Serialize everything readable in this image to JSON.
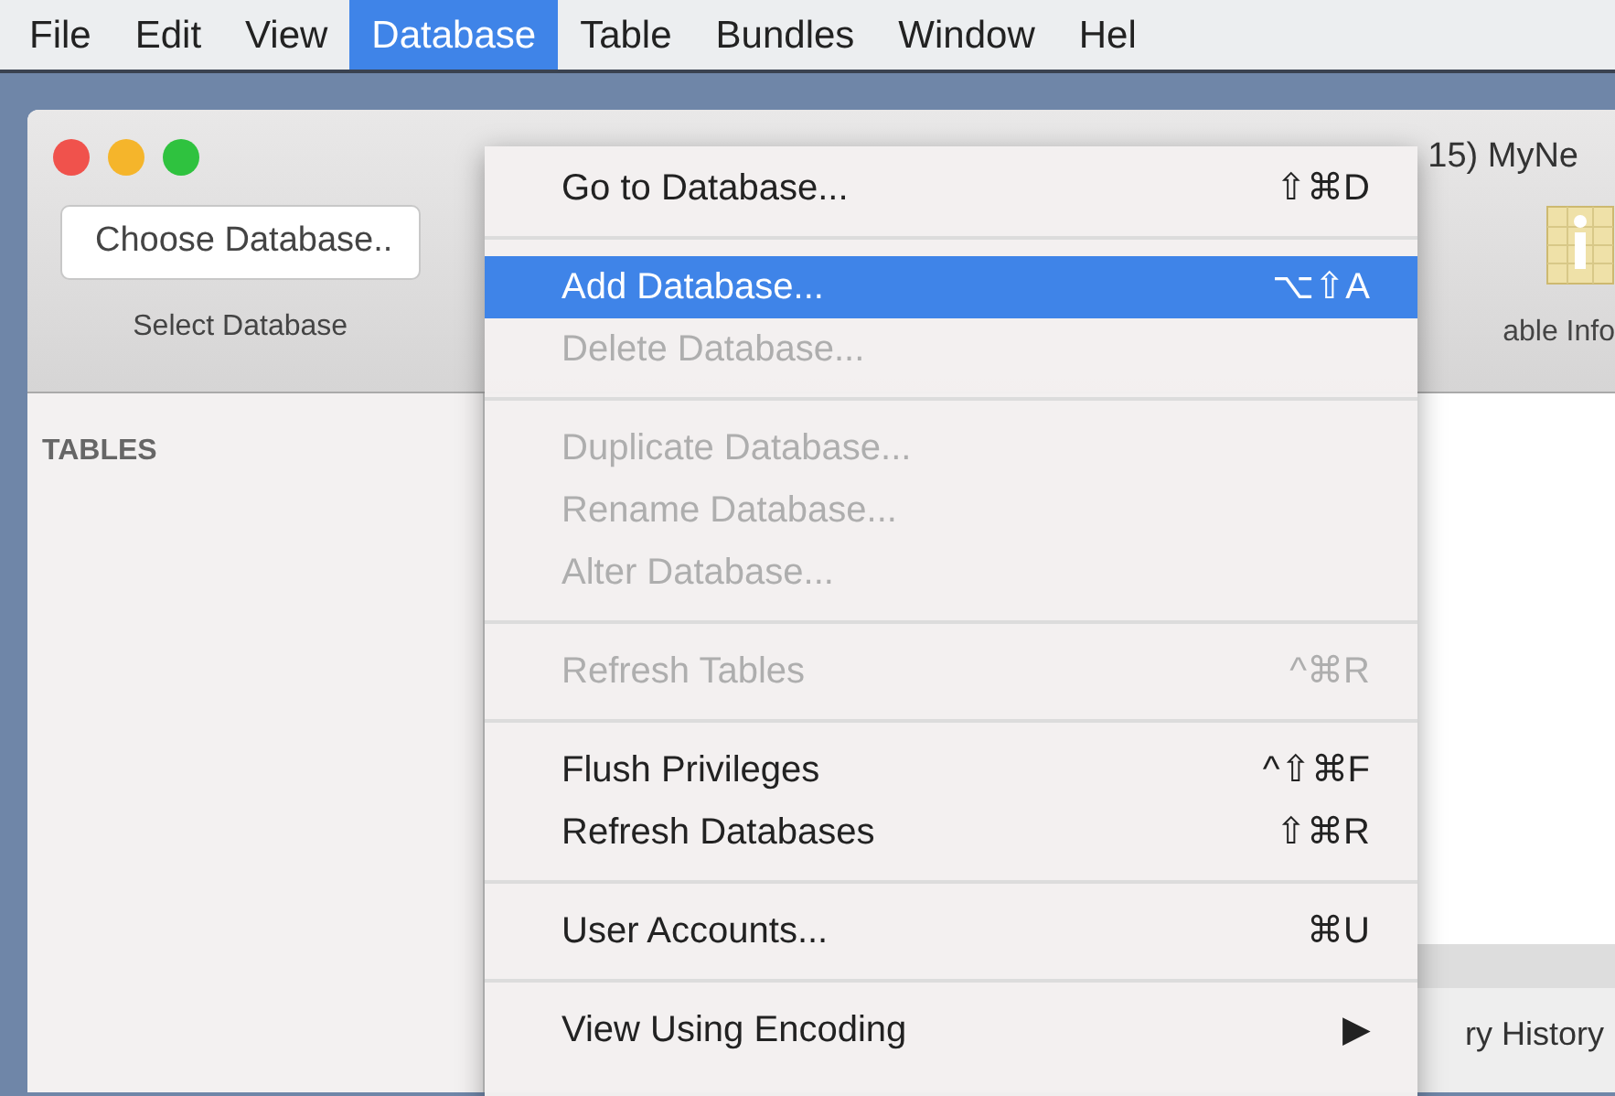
{
  "menu_bar": [
    {
      "label": "File",
      "selected": false
    },
    {
      "label": "Edit",
      "selected": false
    },
    {
      "label": "View",
      "selected": false
    },
    {
      "label": "Database",
      "selected": true
    },
    {
      "label": "Table",
      "selected": false
    },
    {
      "label": "Bundles",
      "selected": false
    },
    {
      "label": "Window",
      "selected": false
    },
    {
      "label": "Hel",
      "selected": false
    }
  ],
  "window": {
    "title": "15) MyNe",
    "toolbar": [
      {
        "kind": "button",
        "label": "Choose Database..",
        "caption": "Select Database"
      },
      {
        "kind": "icon",
        "caption": "able Info"
      }
    ],
    "sidebar": {
      "heading": "TABLES"
    },
    "bottom_tab": "ry History"
  },
  "menu": [
    {
      "kind": "item",
      "label": "Go to Database...",
      "shortcut": "⇧⌘D",
      "disabled": false,
      "selected": false
    },
    {
      "kind": "separator"
    },
    {
      "kind": "item",
      "label": "Add Database...",
      "shortcut": "⌥⇧A",
      "disabled": false,
      "selected": true
    },
    {
      "kind": "item",
      "label": "Delete Database...",
      "disabled": true,
      "selected": false
    },
    {
      "kind": "separator"
    },
    {
      "kind": "item",
      "label": "Duplicate Database...",
      "disabled": true,
      "selected": false
    },
    {
      "kind": "item",
      "label": "Rename Database...",
      "disabled": true,
      "selected": false
    },
    {
      "kind": "item",
      "label": "Alter Database...",
      "disabled": true,
      "selected": false
    },
    {
      "kind": "separator"
    },
    {
      "kind": "item",
      "label": "Refresh Tables",
      "shortcut": "^⌘R",
      "disabled": true,
      "selected": false
    },
    {
      "kind": "separator"
    },
    {
      "kind": "item",
      "label": "Flush Privileges",
      "shortcut": "^⇧⌘F",
      "disabled": false,
      "selected": false
    },
    {
      "kind": "item",
      "label": "Refresh Databases",
      "shortcut": "⇧⌘R",
      "disabled": false,
      "selected": false
    },
    {
      "kind": "separator"
    },
    {
      "kind": "item",
      "label": "User Accounts...",
      "shortcut": "⌘U",
      "disabled": false,
      "selected": false
    },
    {
      "kind": "separator"
    },
    {
      "kind": "item",
      "label": "View Using Encoding",
      "shortcut": "▶",
      "disabled": false,
      "selected": false
    }
  ]
}
